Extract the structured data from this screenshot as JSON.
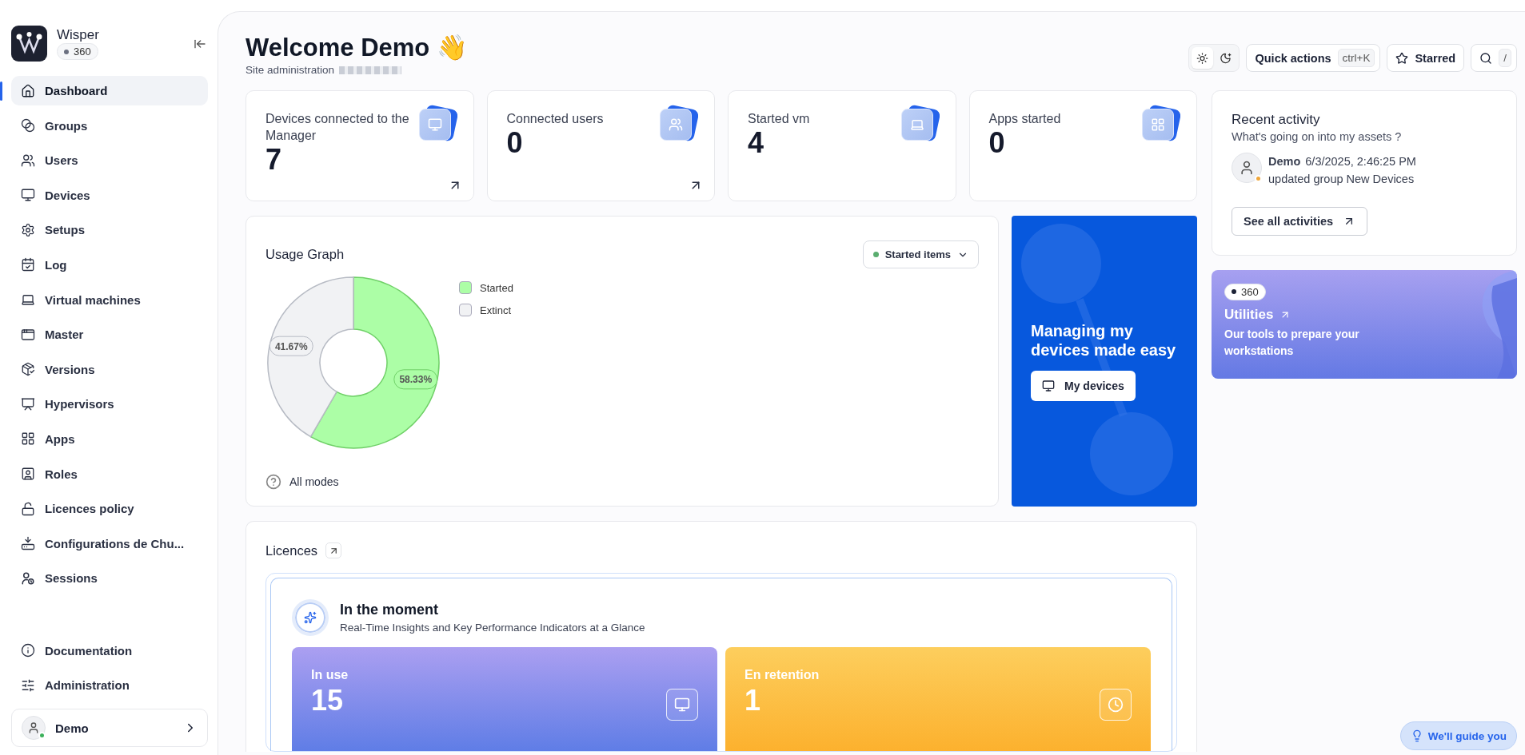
{
  "brand": {
    "name": "Wisper",
    "badge": "360"
  },
  "nav": [
    {
      "label": "Dashboard",
      "selected": true
    },
    {
      "label": "Groups",
      "selected": false
    },
    {
      "label": "Users",
      "selected": false
    },
    {
      "label": "Devices",
      "selected": false
    },
    {
      "label": "Setups",
      "selected": false
    },
    {
      "label": "Log",
      "selected": false
    },
    {
      "label": "Virtual machines",
      "selected": false
    },
    {
      "label": "Master",
      "selected": false
    },
    {
      "label": "Versions",
      "selected": false
    },
    {
      "label": "Hypervisors",
      "selected": false
    },
    {
      "label": "Apps",
      "selected": false
    },
    {
      "label": "Roles",
      "selected": false
    },
    {
      "label": "Licences policy",
      "selected": false
    },
    {
      "label": "Configurations de Chu...",
      "selected": false
    },
    {
      "label": "Sessions",
      "selected": false
    }
  ],
  "nav_footer": [
    {
      "label": "Documentation"
    },
    {
      "label": "Administration"
    }
  ],
  "user": {
    "name": "Demo",
    "online": true
  },
  "header": {
    "title": "Welcome Demo",
    "emoji": "👋",
    "subtitle": "Site administration"
  },
  "theme_modes": [
    {
      "kind": "light",
      "selected": true
    },
    {
      "kind": "dark",
      "selected": false
    }
  ],
  "quick_actions": {
    "label": "Quick actions",
    "shortcut": "ctrl+K"
  },
  "starred": {
    "label": "Starred"
  },
  "search": {
    "shortcut": "/"
  },
  "stats": [
    {
      "kind": "devices",
      "label": "Devices connected to the Manager",
      "value": "7",
      "link": true
    },
    {
      "kind": "users",
      "label": "Connected users",
      "value": "0",
      "link": true
    },
    {
      "kind": "vm",
      "label": "Started vm",
      "value": "4",
      "link": false
    },
    {
      "kind": "apps",
      "label": "Apps started",
      "value": "0",
      "link": false
    }
  ],
  "usage": {
    "title": "Usage Graph",
    "filter": {
      "label": "Started items",
      "color": "#5aad6f"
    },
    "footer": "All modes",
    "chart_data": {
      "type": "donut",
      "categories": [
        "Started",
        "Extinct"
      ],
      "values": [
        58.33,
        41.67
      ],
      "colors": [
        "#acfea6",
        "#f1f2f4"
      ],
      "value_labels": [
        "58.33%",
        "41.67%"
      ]
    }
  },
  "promo": {
    "title": "Managing my devices made easy",
    "button": "My devices"
  },
  "activity": {
    "title": "Recent activity",
    "subtitle": "What's going on into my assets ?",
    "items": [
      {
        "user": "Demo",
        "time": "6/3/2025, 2:46:25 PM",
        "text": "updated group New Devices",
        "color": "#f0a63a"
      }
    ],
    "button": "See all activities"
  },
  "utilities": {
    "badge": "360",
    "title": "Utilities",
    "text": "Our tools to prepare your workstations"
  },
  "licences": {
    "title": "Licences",
    "panel": {
      "title": "In the moment",
      "subtitle": "Real-Time Insights and Key Performance Indicators at a Glance",
      "tiles": [
        {
          "kind": "in_use",
          "label": "In use",
          "value": "15"
        },
        {
          "kind": "retention",
          "label": "En retention",
          "value": "1"
        }
      ]
    }
  },
  "guide": {
    "label": "We'll guide you"
  }
}
